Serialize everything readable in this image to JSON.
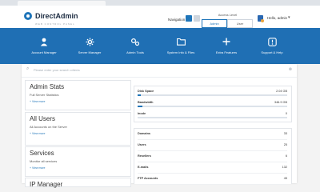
{
  "header": {
    "logo_text": "DirectAdmin",
    "logo_sub": "WEB CONTROL PANEL",
    "navigation_label": "Navigation",
    "access_level_label": "Access Level",
    "access_admin": "Admin",
    "access_user": "User",
    "user_greeting": "Hello, admin"
  },
  "menu": [
    {
      "label": "Account Manager",
      "icon": "user-icon"
    },
    {
      "label": "Server Manager",
      "icon": "server-icon"
    },
    {
      "label": "Admin Tools",
      "icon": "gears-icon"
    },
    {
      "label": "System Info & Files",
      "icon": "folder-icon"
    },
    {
      "label": "Extra Features",
      "icon": "plus-icon"
    },
    {
      "label": "Support & Help",
      "icon": "help-icon"
    }
  ],
  "search": {
    "placeholder": "Please enter your search criteria"
  },
  "panels": [
    {
      "title": "Admin Stats",
      "desc": "Full Server Statistics",
      "more": "+ View more"
    },
    {
      "title": "All Users",
      "desc": "All Accounts on the Server",
      "more": "+ View more"
    },
    {
      "title": "Services",
      "desc": "Monitor all services",
      "more": "+ View more"
    },
    {
      "title": "IP Manager",
      "desc": "",
      "more": ""
    }
  ],
  "usage": [
    {
      "label": "Disk Space",
      "value": "2.04 GB",
      "fraction": 0.02
    },
    {
      "label": "Bandwidth",
      "value": "346.9 GB",
      "fraction": 0.03
    },
    {
      "label": "Inode",
      "value": "0",
      "fraction": 0.0
    }
  ],
  "counts": [
    {
      "label": "Domains",
      "value": "33"
    },
    {
      "label": "Users",
      "value": "25"
    },
    {
      "label": "Resellers",
      "value": "6"
    },
    {
      "label": "E-mails",
      "value": "132"
    },
    {
      "label": "FTP Accounts",
      "value": "45"
    }
  ],
  "colors": {
    "brand": "#1f6fb4",
    "accent": "#1f75b9"
  }
}
